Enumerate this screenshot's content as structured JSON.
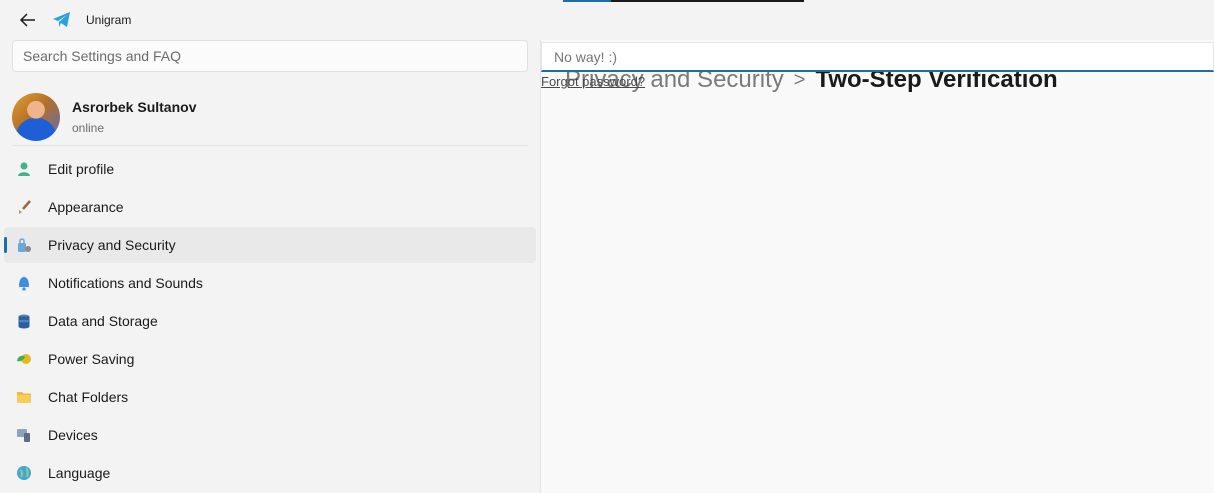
{
  "window": {
    "title": "Unigram"
  },
  "search": {
    "placeholder": "Search Settings and FAQ"
  },
  "profile": {
    "name": "Asrorbek Sultanov",
    "status": "online"
  },
  "menu": [
    {
      "label": "Edit profile",
      "icon": "person-icon",
      "selected": false
    },
    {
      "label": "Appearance",
      "icon": "brush-icon",
      "selected": false
    },
    {
      "label": "Privacy and Security",
      "icon": "lock-icon",
      "selected": true
    },
    {
      "label": "Notifications and Sounds",
      "icon": "bell-icon",
      "selected": false
    },
    {
      "label": "Data and Storage",
      "icon": "database-icon",
      "selected": false
    },
    {
      "label": "Power Saving",
      "icon": "battery-leaf-icon",
      "selected": false
    },
    {
      "label": "Chat Folders",
      "icon": "folder-icon",
      "selected": false
    },
    {
      "label": "Devices",
      "icon": "devices-icon",
      "selected": false
    },
    {
      "label": "Language",
      "icon": "globe-icon",
      "selected": false
    }
  ],
  "breadcrumb": {
    "parent": "Privacy and Security",
    "separator": ">",
    "current": "Two-Step Verification"
  },
  "password": {
    "placeholder": "No way! :)",
    "value": ""
  },
  "forgot": {
    "label": "Forgot password?"
  },
  "colors": {
    "accent": "#1b6ea6",
    "sidebar_bg": "#f3f3f3",
    "pane_bg": "#f9f9f9"
  }
}
